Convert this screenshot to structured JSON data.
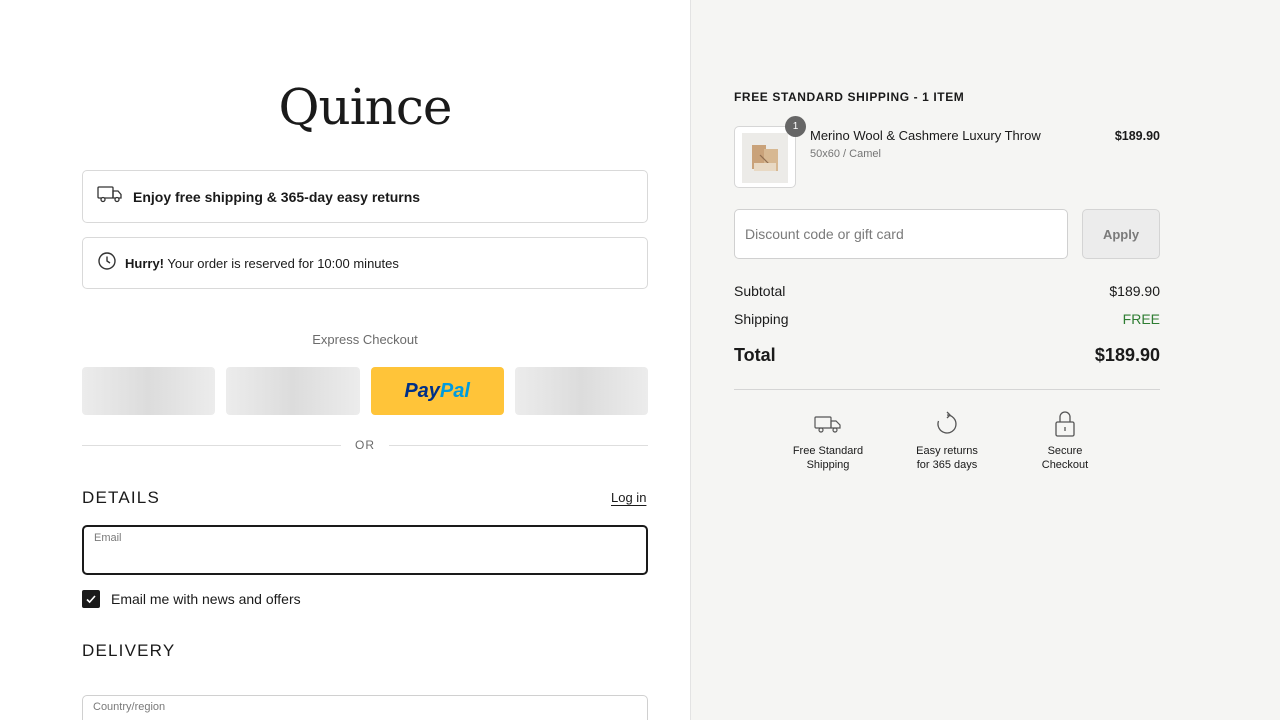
{
  "brand": {
    "logo_text": "Quince"
  },
  "notices": {
    "shipping": "Enjoy free shipping & 365-day easy returns",
    "timer_bold": "Hurry!",
    "timer_text": " Your order is reserved for 10:00 minutes"
  },
  "express": {
    "title": "Express Checkout",
    "paypal_part1": "Pay",
    "paypal_part2": "Pal"
  },
  "divider_or": "OR",
  "details": {
    "title": "DETAILS",
    "login_label": "Log in",
    "email_label": "Email",
    "email_value": "",
    "newsletter_label": "Email me with news and offers",
    "newsletter_checked": true
  },
  "delivery": {
    "title": "DELIVERY",
    "country_label": "Country/region"
  },
  "summary": {
    "heading": "FREE STANDARD SHIPPING - 1 ITEM",
    "item": {
      "quantity": "1",
      "name": "Merino Wool & Cashmere Luxury Throw",
      "variant": "50x60 / Camel",
      "price": "$189.90"
    },
    "discount_placeholder": "Discount code or gift card",
    "apply_label": "Apply",
    "subtotal_label": "Subtotal",
    "subtotal_value": "$189.90",
    "shipping_label": "Shipping",
    "shipping_value": "FREE",
    "total_label": "Total",
    "total_value": "$189.90",
    "perks": [
      {
        "line1": "Free Standard",
        "line2": "Shipping",
        "icon": "truck-icon"
      },
      {
        "line1": "Easy returns",
        "line2": "for 365 days",
        "icon": "return-icon"
      },
      {
        "line1": "Secure",
        "line2": "Checkout",
        "icon": "lock-icon"
      }
    ]
  },
  "colors": {
    "accent": "#1a1a1a",
    "paypal_yellow": "#ffc439",
    "free_green": "#2e7d32",
    "sidebar_bg": "#f5f5f3"
  }
}
